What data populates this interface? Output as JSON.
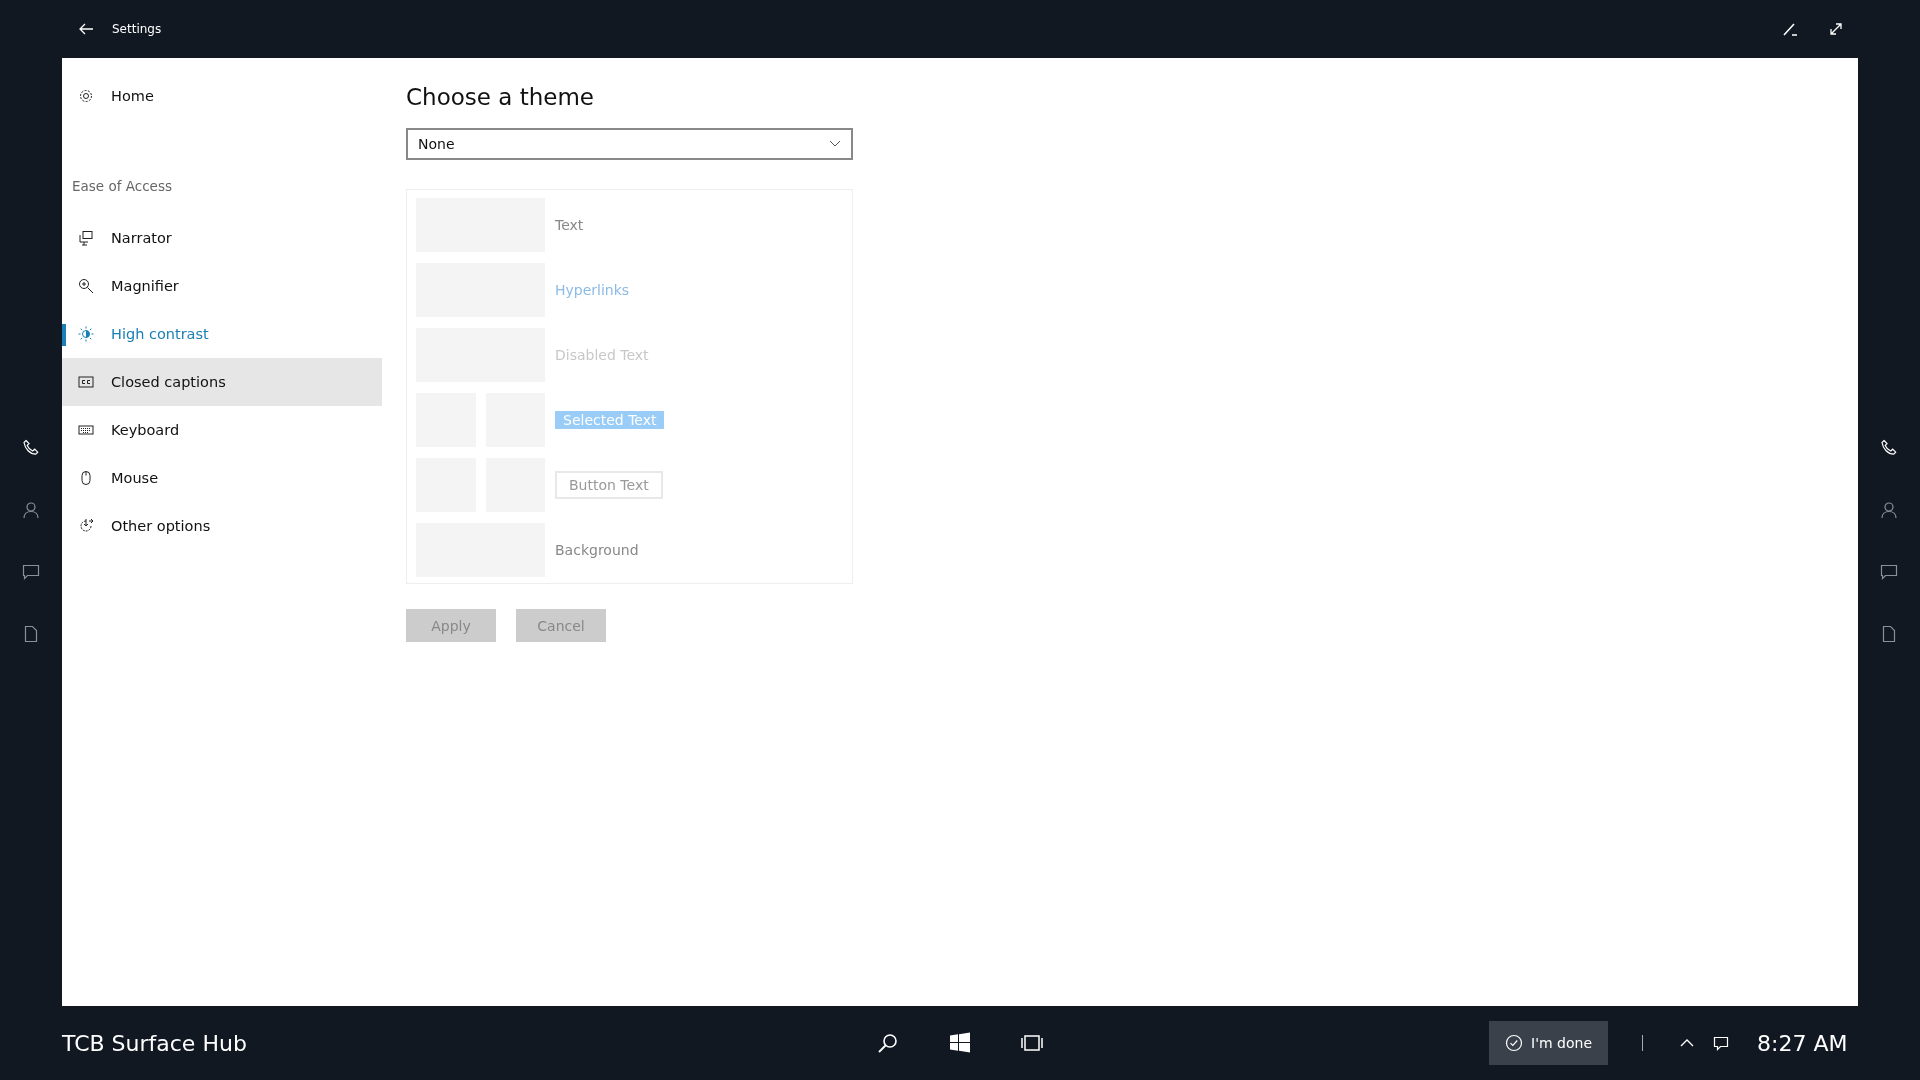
{
  "window": {
    "title": "Settings"
  },
  "sidebar": {
    "home": {
      "label": "Home"
    },
    "section": "Ease of Access",
    "items": [
      {
        "label": "Narrator",
        "selected": false,
        "hovered": false
      },
      {
        "label": "Magnifier",
        "selected": false,
        "hovered": false
      },
      {
        "label": "High contrast",
        "selected": true,
        "hovered": false
      },
      {
        "label": "Closed captions",
        "selected": false,
        "hovered": true
      },
      {
        "label": "Keyboard",
        "selected": false,
        "hovered": false
      },
      {
        "label": "Mouse",
        "selected": false,
        "hovered": false
      },
      {
        "label": "Other options",
        "selected": false,
        "hovered": false
      }
    ]
  },
  "main": {
    "heading": "Choose a theme",
    "theme_dropdown": {
      "value": "None"
    },
    "preview": [
      {
        "kind": "text",
        "label": "Text"
      },
      {
        "kind": "link",
        "label": "Hyperlinks"
      },
      {
        "kind": "disabled",
        "label": "Disabled Text"
      },
      {
        "kind": "selected",
        "label": "Selected Text"
      },
      {
        "kind": "button",
        "label": "Button Text"
      },
      {
        "kind": "background",
        "label": "Background"
      }
    ],
    "buttons": [
      {
        "label": "Apply",
        "disabled": true
      },
      {
        "label": "Cancel",
        "disabled": true
      }
    ]
  },
  "taskbar": {
    "device_name": "TCB Surface Hub",
    "done_button": "I'm done",
    "clock": "8:27 AM"
  }
}
